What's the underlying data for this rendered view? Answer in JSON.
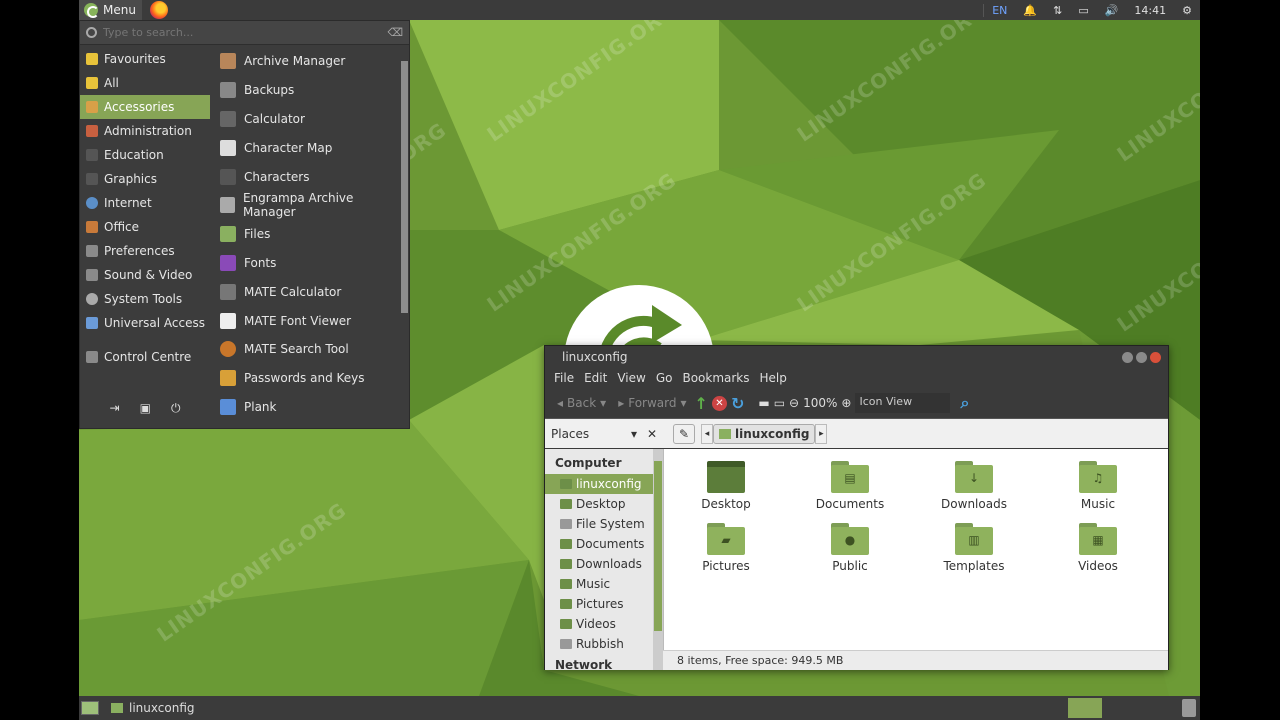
{
  "top_panel": {
    "menu_label": "Menu",
    "lang": "EN",
    "clock": "14:41"
  },
  "watermark": "LINUXCONFIG.ORG",
  "menu": {
    "search_placeholder": "Type to search...",
    "categories": [
      "Favourites",
      "All",
      "Accessories",
      "Administration",
      "Education",
      "Graphics",
      "Internet",
      "Office",
      "Preferences",
      "Sound & Video",
      "System Tools",
      "Universal Access",
      "Control Centre"
    ],
    "active_category": "Accessories",
    "apps": [
      "Archive Manager",
      "Backups",
      "Calculator",
      "Character Map",
      "Characters",
      "Engrampa Archive Manager",
      "Files",
      "Fonts",
      "MATE Calculator",
      "MATE Font Viewer",
      "MATE Search Tool",
      "Passwords and Keys",
      "Plank"
    ]
  },
  "file_manager": {
    "title": "linuxconfig",
    "menubar": [
      "File",
      "Edit",
      "View",
      "Go",
      "Bookmarks",
      "Help"
    ],
    "toolbar": {
      "back": "Back",
      "forward": "Forward",
      "zoom": "100%",
      "view_mode": "Icon View"
    },
    "places_label": "Places",
    "breadcrumb": "linuxconfig",
    "sidebar_section": "Computer",
    "sidebar_items": [
      "linuxconfig",
      "Desktop",
      "File System",
      "Documents",
      "Downloads",
      "Music",
      "Pictures",
      "Videos",
      "Rubbish"
    ],
    "sidebar_partial": "Network",
    "items": [
      "Desktop",
      "Documents",
      "Downloads",
      "Music",
      "Pictures",
      "Public",
      "Templates",
      "Videos"
    ],
    "status": "8 items, Free space: 949.5 MB"
  },
  "bottom_panel": {
    "task_label": "linuxconfig"
  },
  "colors": {
    "accent": "#87a556",
    "wallpaper": "#6f9a35",
    "panel": "#3b3b3b"
  }
}
